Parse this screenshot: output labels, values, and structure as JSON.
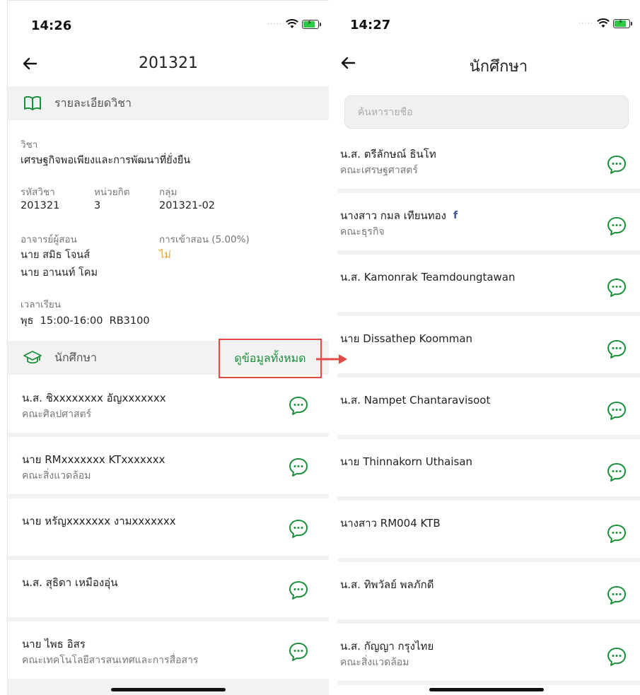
{
  "left": {
    "status": {
      "time": "14:26"
    },
    "nav": {
      "title": "201321"
    },
    "details_section": {
      "title": "รายละเอียดวิชา"
    },
    "course": {
      "subject_label": "วิชา",
      "subject_value": "เศรษฐกิจพอเพียงและการพัฒนาที่ยั่งยืน",
      "code_label": "รหัสวิชา",
      "code_value": "201321",
      "credit_label": "หน่วยกิต",
      "credit_value": "3",
      "group_label": "กลุ่ม",
      "group_value": "201321-02",
      "instructor_label": "อาจารย์ผู้สอน",
      "instructors": [
        "นาย สมิธ โจนส์",
        "นาย อานนท์ โคม"
      ],
      "attendance_label": "การเข้าสอน (5.00%)",
      "attendance_value": "ไม่",
      "schedule_label": "เวลาเรียน",
      "schedule_value": "พุธ  15:00-16:00  RB3100"
    },
    "students_section": {
      "title": "นักศึกษา",
      "see_all": "ดูข้อมูลทั้งหมด"
    },
    "students": [
      {
        "name": "น.ส. ชิxxxxxxxx อัญxxxxxxx",
        "faculty": "คณะศิลปศาสตร์"
      },
      {
        "name": "นาย RMxxxxxxx KTxxxxxxx",
        "faculty": "คณะสิ่งแวดล้อม"
      },
      {
        "name": "นาย หรัญxxxxxxx งามxxxxxxx",
        "faculty": ""
      },
      {
        "name": "น.ส. สุธิดา เหมืองอุ่น",
        "faculty": ""
      },
      {
        "name": "นาย ไพธ อิสร",
        "faculty": "คณะเทคโนโลยีสารสนเทศและการสื่อสาร"
      }
    ]
  },
  "right": {
    "status": {
      "time": "14:27"
    },
    "nav": {
      "title": "นักศึกษา"
    },
    "search": {
      "placeholder": "ค้นหารายชื่อ"
    },
    "students": [
      {
        "name": "น.ส. ตรีลักษณ์ ธินโท",
        "faculty": "คณะเศรษฐศาสตร์"
      },
      {
        "name": "นางสาว กมล เทียนทอง",
        "faculty": "คณะธุรกิจ",
        "badge": "f"
      },
      {
        "name": "น.ส. Kamonrak Teamdoungtawan",
        "faculty": ""
      },
      {
        "name": "นาย Dissathep Koomman",
        "faculty": ""
      },
      {
        "name": "น.ส. Nampet Chantaravisoot",
        "faculty": ""
      },
      {
        "name": "นาย Thinnakorn Uthaisan",
        "faculty": ""
      },
      {
        "name": "นางสาว RM004 KTB",
        "faculty": ""
      },
      {
        "name": "น.ส. ทิพวัลย์ พลภักดี",
        "faculty": ""
      },
      {
        "name": "น.ส. กัญญา กรุงไทย",
        "faculty": "คณะสิ่งแวดล้อม"
      }
    ]
  },
  "colors": {
    "accent_green": "#1a8f3a",
    "highlight_red": "#e04b45",
    "attendance_yellow": "#e9a21a",
    "section_bg": "#f2f2f2"
  },
  "icons": {
    "book": "book-icon",
    "graduation": "graduation-cap-icon",
    "chat": "chat-bubble-icon",
    "back": "back-arrow-icon",
    "wifi": "wifi-icon",
    "battery": "battery-charging-icon",
    "facebook": "facebook-icon"
  }
}
